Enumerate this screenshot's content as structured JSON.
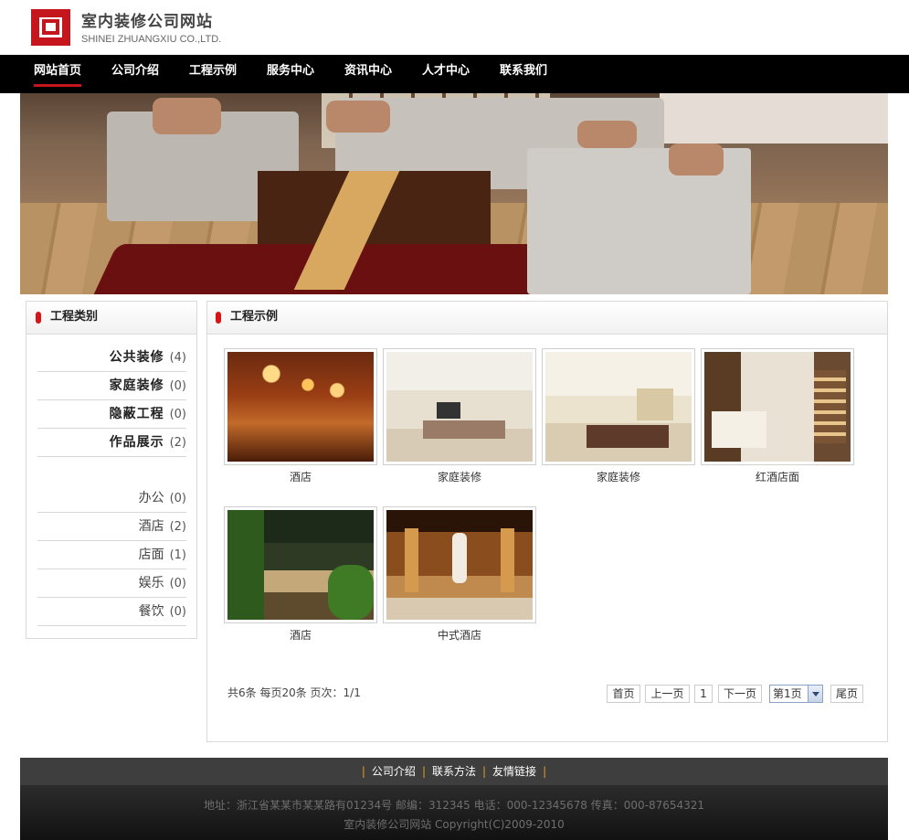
{
  "site": {
    "title": "室内装修公司网站",
    "subtitle": "SHINEI ZHUANGXIU CO.,LTD."
  },
  "nav": {
    "items": [
      "网站首页",
      "公司介绍",
      "工程示例",
      "服务中心",
      "资讯中心",
      "人才中心",
      "联系我们"
    ],
    "active": "网站首页"
  },
  "sidebar": {
    "title": "工程类别",
    "categories": [
      {
        "name": "公共装修",
        "count": "(4)"
      },
      {
        "name": "家庭装修",
        "count": "(0)"
      },
      {
        "name": "隐蔽工程",
        "count": "(0)"
      },
      {
        "name": "作品展示",
        "count": "(2)"
      }
    ],
    "subcategories": [
      {
        "name": "办公",
        "count": "(0)"
      },
      {
        "name": "酒店",
        "count": "(2)"
      },
      {
        "name": "店面",
        "count": "(1)"
      },
      {
        "name": "娱乐",
        "count": "(0)"
      },
      {
        "name": "餐饮",
        "count": "(0)"
      }
    ]
  },
  "main": {
    "title": "工程示例",
    "projects": [
      {
        "caption": "酒店",
        "image": "hotel-interior"
      },
      {
        "caption": "家庭装修",
        "image": "home-living-room"
      },
      {
        "caption": "家庭装修",
        "image": "home-living-room-2"
      },
      {
        "caption": "红酒店面",
        "image": "wine-shop"
      },
      {
        "caption": "酒店",
        "image": "hotel-lobby"
      },
      {
        "caption": "中式酒店",
        "image": "chinese-hotel"
      }
    ],
    "pager": {
      "info": "共6条  每页20条  页次：1/1",
      "first": "首页",
      "prev": "上一页",
      "current": "1",
      "next": "下一页",
      "select": "第1页",
      "last": "尾页"
    }
  },
  "footer": {
    "links": [
      "公司介绍",
      "联系方法",
      "友情链接"
    ],
    "address": "地址：浙江省某某市某某路有01234号 邮编：312345 电话：000-12345678 传真：000-87654321",
    "copyright": "室内装修公司网站 Copyright(C)2009-2010"
  },
  "colors": {
    "brand_red": "#c4161c",
    "nav_bg": "#000000",
    "footer_bg": "#3e3e3e"
  }
}
